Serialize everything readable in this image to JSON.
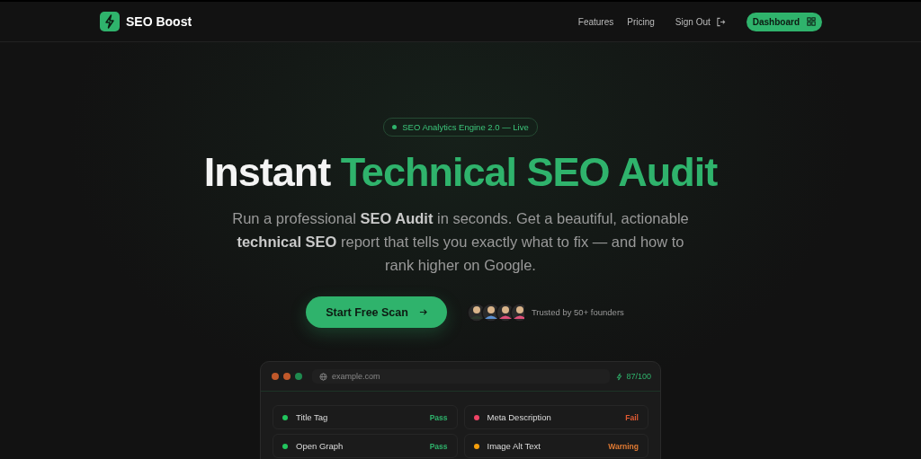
{
  "nav": {
    "brand": "SEO Boost",
    "links": [
      "Features",
      "Pricing"
    ],
    "sign_out": "Sign Out",
    "dashboard": "Dashboard"
  },
  "hero": {
    "badge": "SEO Analytics Engine 2.0 — Live",
    "title_white": "Instant",
    "title_green": "Technical SEO Audit",
    "subtitle": "Run a professional **SEO Audit** in seconds. Get a beautiful, actionable **technical SEO** report that tells you exactly what to fix — and how to rank higher on Google.",
    "cta": "Start Free Scan",
    "trusted": "Trusted by 50+ founders"
  },
  "preview": {
    "url": "example.com",
    "score": "87/100",
    "checks": [
      {
        "name": "Title Tag",
        "status": "Pass",
        "color": "#22c55e"
      },
      {
        "name": "Meta Description",
        "status": "Fail",
        "color": "#ef4466"
      },
      {
        "name": "Open Graph",
        "status": "Pass",
        "color": "#22c55e"
      },
      {
        "name": "Image Alt Text",
        "status": "Warning",
        "color": "#f59e0b"
      }
    ]
  }
}
